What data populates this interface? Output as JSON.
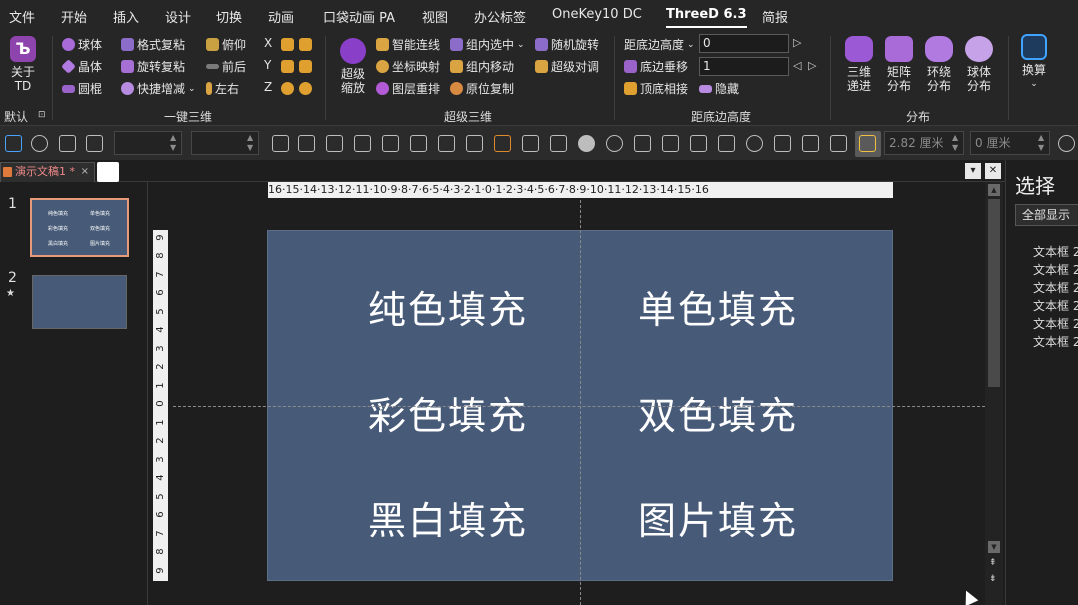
{
  "menu": {
    "items": [
      "文件",
      "开始",
      "插入",
      "设计",
      "切换",
      "动画",
      "口袋动画 PA",
      "视图",
      "办公标签",
      "OneKey10 DC",
      "ThreeD 6.3",
      "简报"
    ],
    "active": "ThreeD 6.3"
  },
  "ribbon": {
    "about": {
      "label_line1": "关于",
      "label_line2": "TD"
    },
    "default_label": "默认",
    "group1": {
      "label": "一键三维",
      "col1": [
        "球体",
        "晶体",
        "圆棍"
      ],
      "col2": [
        "格式复粘",
        "旋转复粘",
        "快捷增减"
      ],
      "col3": [
        "俯仰",
        "前后",
        "左右"
      ],
      "axes": [
        "X",
        "Y",
        "Z"
      ]
    },
    "group2": {
      "label": "超级三维",
      "big_line1": "超级",
      "big_line2": "缩放",
      "col1": [
        "智能连线",
        "坐标映射",
        "图层重排"
      ],
      "col2": [
        "组内选中",
        "组内移动",
        "原位复制"
      ],
      "col3": [
        "随机旋转",
        "超级对调"
      ]
    },
    "group3": {
      "label": "距底边高度",
      "row_labels": [
        "距底边高度",
        "底边垂移",
        "顶底相接"
      ],
      "values": [
        "0",
        "1"
      ],
      "hide_label": "隐藏"
    },
    "group4": {
      "label": "分布",
      "buttons": [
        {
          "line1": "三维",
          "line2": "递进"
        },
        {
          "line1": "矩阵",
          "line2": "分布"
        },
        {
          "line1": "环绕",
          "line2": "分布"
        },
        {
          "line1": "球体",
          "line2": "分布"
        }
      ]
    },
    "switch_label": "换算"
  },
  "toolbar": {
    "field1": "",
    "field2": "",
    "size_value": "2.82 厘米",
    "offset_value": "0 厘米"
  },
  "tabs": {
    "doc_title": "演示文稿1 *",
    "close_glyph": "×"
  },
  "thumbnails": {
    "numbers": [
      "1",
      "2"
    ],
    "mini_labels": [
      "纯色填充",
      "单色填充",
      "彩色填充",
      "双色填充",
      "黑白填充",
      "图片填充"
    ]
  },
  "ruler": {
    "horizontal": "16·15·14·13·12·11·10·9·8·7·6·5·4·3·2·1·0·1·2·3·4·5·6·7·8·9·10·11·12·13·14·15·16",
    "vertical": [
      "9",
      "8",
      "7",
      "6",
      "5",
      "4",
      "3",
      "2",
      "1",
      "0",
      "1",
      "2",
      "3",
      "4",
      "5",
      "6",
      "7",
      "8",
      "9"
    ]
  },
  "slide": {
    "cells": [
      "纯色填充",
      "单色填充",
      "彩色填充",
      "双色填充",
      "黑白填充",
      "图片填充"
    ]
  },
  "selection_pane": {
    "title": "选择",
    "show_all": "全部显示",
    "items": [
      "文本框 2",
      "文本框 2",
      "文本框 2",
      "文本框 2",
      "文本框 2",
      "文本框 2"
    ]
  },
  "colors": {
    "slide_bg": "#475a77",
    "ribbon_bg": "#262626",
    "accent_purple": "#9b59d6",
    "thumb_border": "#e89b7a"
  }
}
